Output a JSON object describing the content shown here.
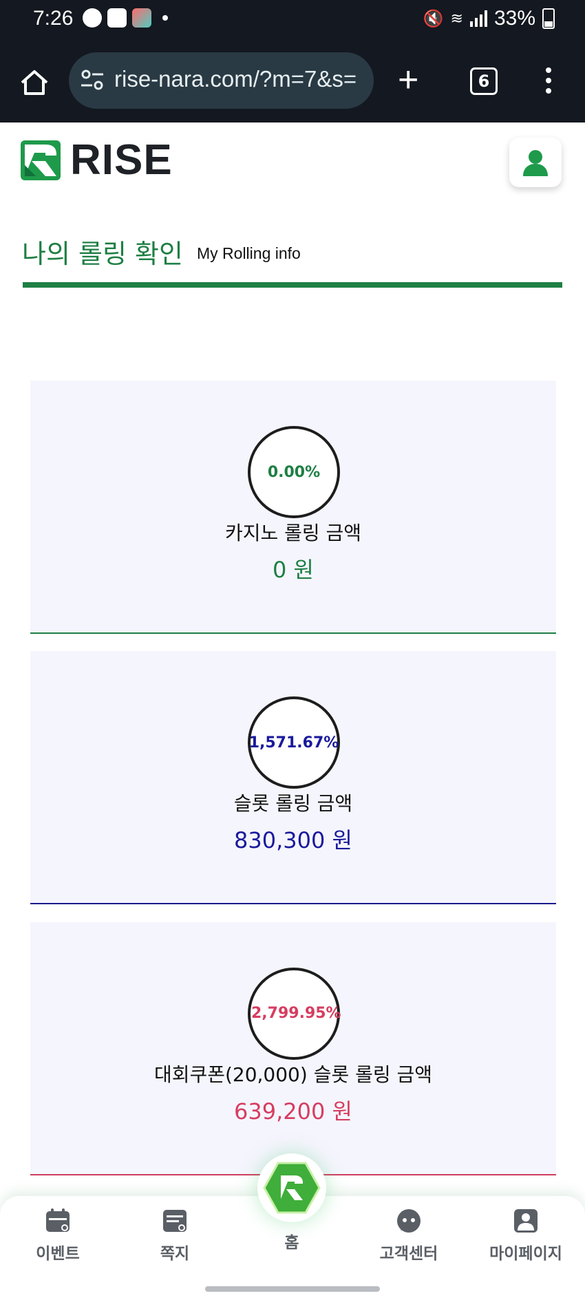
{
  "status_bar": {
    "time": "7:26",
    "battery": "33%",
    "notification_icons": [
      "talk-icon",
      "image-icon",
      "game-app-icon"
    ],
    "system_icons": [
      "mute-icon",
      "wifi-icon",
      "signal-icon",
      "battery-icon"
    ]
  },
  "browser": {
    "url": "rise-nara.com/?m=7&s=",
    "tab_count": "6"
  },
  "header": {
    "logo_text": "RISE"
  },
  "page": {
    "title": "나의 롤링 확인",
    "subtitle": "My Rolling info"
  },
  "cards": [
    {
      "percent": "0.00%",
      "label": "카지노 롤링 금액",
      "amount": "0 원",
      "color": "#1e7f44"
    },
    {
      "percent": "1,571.67%",
      "label": "슬롯 롤링 금액",
      "amount": "830,300 원",
      "color": "#1a1a9c"
    },
    {
      "percent": "2,799.95%",
      "label": "대회쿠폰(20,000) 슬롯 롤링 금액",
      "amount": "639,200 원",
      "color": "#d63d61"
    }
  ],
  "bottom_nav": {
    "items": [
      {
        "label": "이벤트",
        "icon": "calendar-icon"
      },
      {
        "label": "쪽지",
        "icon": "note-icon"
      },
      {
        "label": "홈",
        "icon": "home-logo-icon"
      },
      {
        "label": "고객센터",
        "icon": "chat-bubble-icon"
      },
      {
        "label": "마이페이지",
        "icon": "user-icon"
      }
    ]
  },
  "colors": {
    "brand_green": "#1e7f44",
    "slot_blue": "#1a1a9c",
    "coupon_red": "#d63d61",
    "card_bg": "#f5f5fd",
    "browser_bg": "#141820"
  }
}
